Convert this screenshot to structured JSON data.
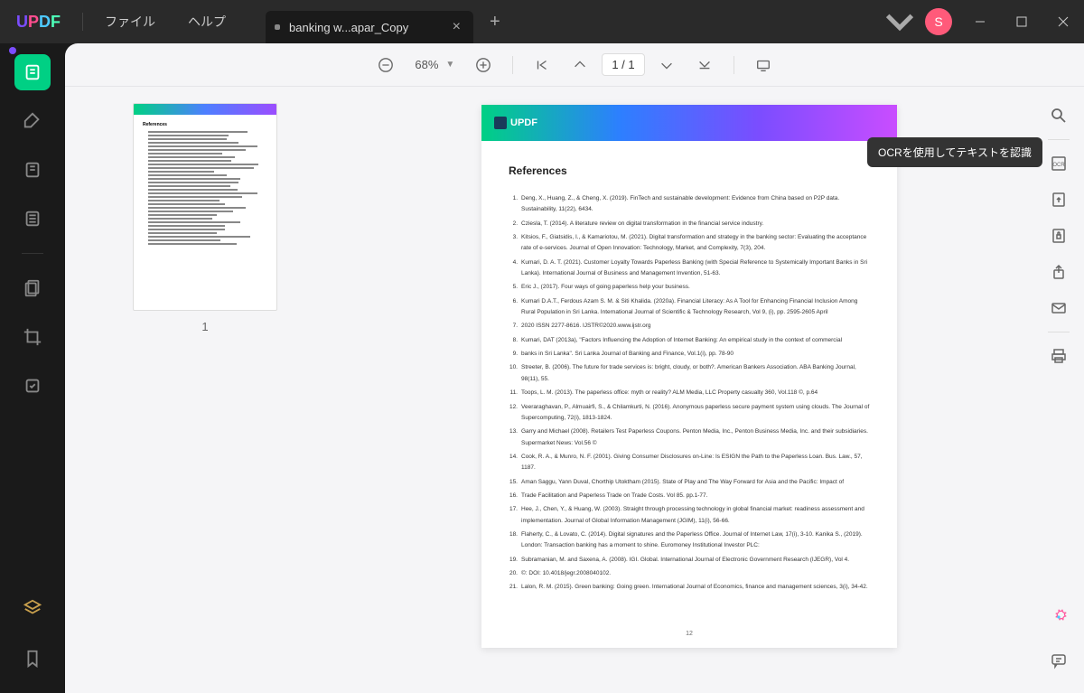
{
  "menu": {
    "file": "ファイル",
    "help": "ヘルプ"
  },
  "tab": {
    "title": "banking w...apar_Copy"
  },
  "avatar_letter": "S",
  "toolbar": {
    "zoom": "68%",
    "page": "1  /  1"
  },
  "thumb_num": "1",
  "tooltip_ocr": "OCRを使用してテキストを認識",
  "page_logo": "UPDF",
  "refs_heading": "References",
  "page_num": "12",
  "refs": [
    {
      "n": "1.",
      "t": "Deng, X., Huang, Z., & Cheng, X. (2019). FinTech and sustainable development: Evidence from China based on P2P data. Sustainability, 11(22), 6434."
    },
    {
      "n": "2.",
      "t": "Cziesla, T. (2014). A literature review on digital transformation in the financial service industry."
    },
    {
      "n": "3.",
      "t": "Kitsios, F., Giatsidis, I., & Kamariotou, M. (2021). Digital transformation and strategy in the banking sector: Evaluating the acceptance rate of e-services. Journal of Open Innovation: Technology, Market, and Complexity, 7(3), 204."
    },
    {
      "n": "4.",
      "t": "Kumari, D. A. T. (2021). Customer Loyalty Towards Paperless Banking (with Special Reference to Systemically Important Banks in Sri Lanka). International Journal of Business and Management Invention, 51-63."
    },
    {
      "n": "5.",
      "t": "Eric J., (2017). Four ways of going paperless help your business."
    },
    {
      "n": "6.",
      "t": "Kumari D.A.T., Ferdous Azam S. M. & Siti Khalida. (2020a). Financial Literacy: As A Tool for Enhancing Financial Inclusion Among Rural Population in Sri Lanka. International Journal of Scientific & Technology Research, Vol 9, (i), pp. 2595-2605 April"
    },
    {
      "n": "7.",
      "t": "2020 ISSN 2277-8616. IJSTR©2020.www.ijstr.org"
    },
    {
      "n": "8.",
      "t": "Kumari, DAT (2013a), \"Factors Influencing the Adoption of Internet Banking: An empirical study in the context of commercial"
    },
    {
      "n": "9.",
      "t": "banks  in Sri Lanka\". Sri Lanka Journal of Banking and Finance, Vol.1(i), pp. 78-90"
    },
    {
      "n": "10.",
      "t": "Streeter, B. (2006). The future for trade services is: bright, cloudy, or both?. American Bankers Association. ABA Banking Journal, 98(11), 55."
    },
    {
      "n": "11.",
      "t": "Toops, L. M. (2013). The paperless office: myth or reality? ALM Media, LLC Property casualty 360, Vol.118 ©, p.64"
    },
    {
      "n": "12.",
      "t": "Veeraraghavan, P., Almuairfi, S., & Chilamkurti, N. (2016). Anonymous paperless secure payment system using clouds. The Journal of Supercomputing, 72(i), 1813-1824."
    },
    {
      "n": "13.",
      "t": "Garry and Michael (2008). Retailers Test Paperless Coupons. Penton Media, Inc., Penton Business Media, Inc. and their subsidiaries. Supermarket News: Vol.56 ©"
    },
    {
      "n": "14.",
      "t": "Cook, R. A., & Munro, N. F. (2001). Giving Consumer Disclosures on-Line: Is ESIGN the Path to the Paperless Loan. Bus. Law., 57, 1187."
    },
    {
      "n": "15.",
      "t": "Aman Saggu, Yann Duval, Chorthip Utoktham (2015). State of Play and The Way Forward for Asia and the Pacific: Impact of"
    },
    {
      "n": "16.",
      "t": "Trade Facilitation and Paperless Trade on Trade Costs. Vol 85. pp.1-77."
    },
    {
      "n": "17.",
      "t": "Hee, J., Chen, Y., & Huang, W. (2003). Straight through processing technology in global financial market: readiness assessment and implementation. Journal of Global Information Management (JGIM), 11(i), 56-66."
    },
    {
      "n": "18.",
      "t": "Flaherty, C., & Lovato, C. (2014). Digital signatures and the Paperless Office. Journal of Internet Law, 17(i), 3-10. Kanika S., (2019). London: Transaction banking has a moment to shine. Euromoney Institutional Investor PLC:"
    },
    {
      "n": "19.",
      "t": "Subramanian, M. and Saxena, A. (2008). IGI. Global. International Journal of Electronic Government Research (IJEGR), Vol 4."
    },
    {
      "n": "20.",
      "t": "©: DOI: 10.4018/jegr.2008040102."
    },
    {
      "n": "21.",
      "t": "Lalon, R. M. (2015). Green banking: Going green. International Journal of Economics, finance and management sciences, 3(i), 34-42."
    }
  ]
}
